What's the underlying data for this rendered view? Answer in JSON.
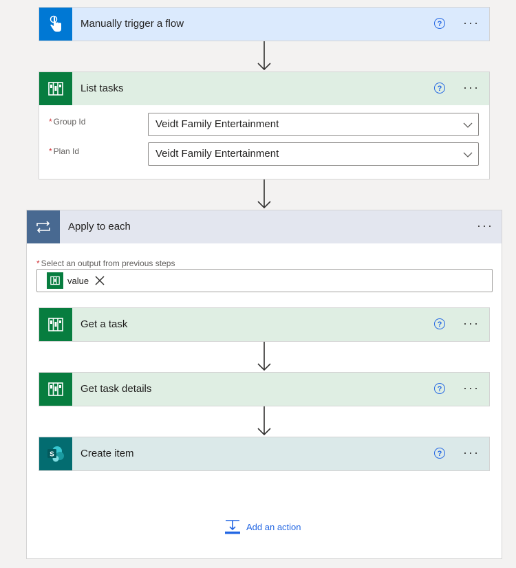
{
  "colors": {
    "trigger_header": "#dbeafd",
    "trigger_icon_bg": "#0078d4",
    "planner_header": "#dfeee3",
    "planner_icon_bg": "#077d3f",
    "loop_header": "#e3e6ef",
    "loop_icon_bg": "#486991",
    "sharepoint_header": "#dbe9e9",
    "sharepoint_icon_bg": "#036c70",
    "link": "#2266e3"
  },
  "trigger": {
    "title": "Manually trigger a flow",
    "icon": "touch-hand-icon"
  },
  "list_tasks": {
    "title": "List tasks",
    "icon": "planner-icon",
    "fields": [
      {
        "required": "*",
        "label": "Group Id",
        "value": "Veidt Family Entertainment"
      },
      {
        "required": "*",
        "label": "Plan Id",
        "value": "Veidt Family Entertainment"
      }
    ]
  },
  "apply_to_each": {
    "title": "Apply to each",
    "icon": "loop-icon",
    "select_label_required": "*",
    "select_label": "Select an output from previous steps",
    "token_value": "value",
    "actions": [
      {
        "title": "Get a task",
        "icon": "planner-icon"
      },
      {
        "title": "Get task details",
        "icon": "planner-icon"
      },
      {
        "title": "Create item",
        "icon": "sharepoint-icon"
      }
    ],
    "add_action": "Add an action"
  },
  "common": {
    "help_glyph": "?",
    "more_glyph": "···"
  }
}
